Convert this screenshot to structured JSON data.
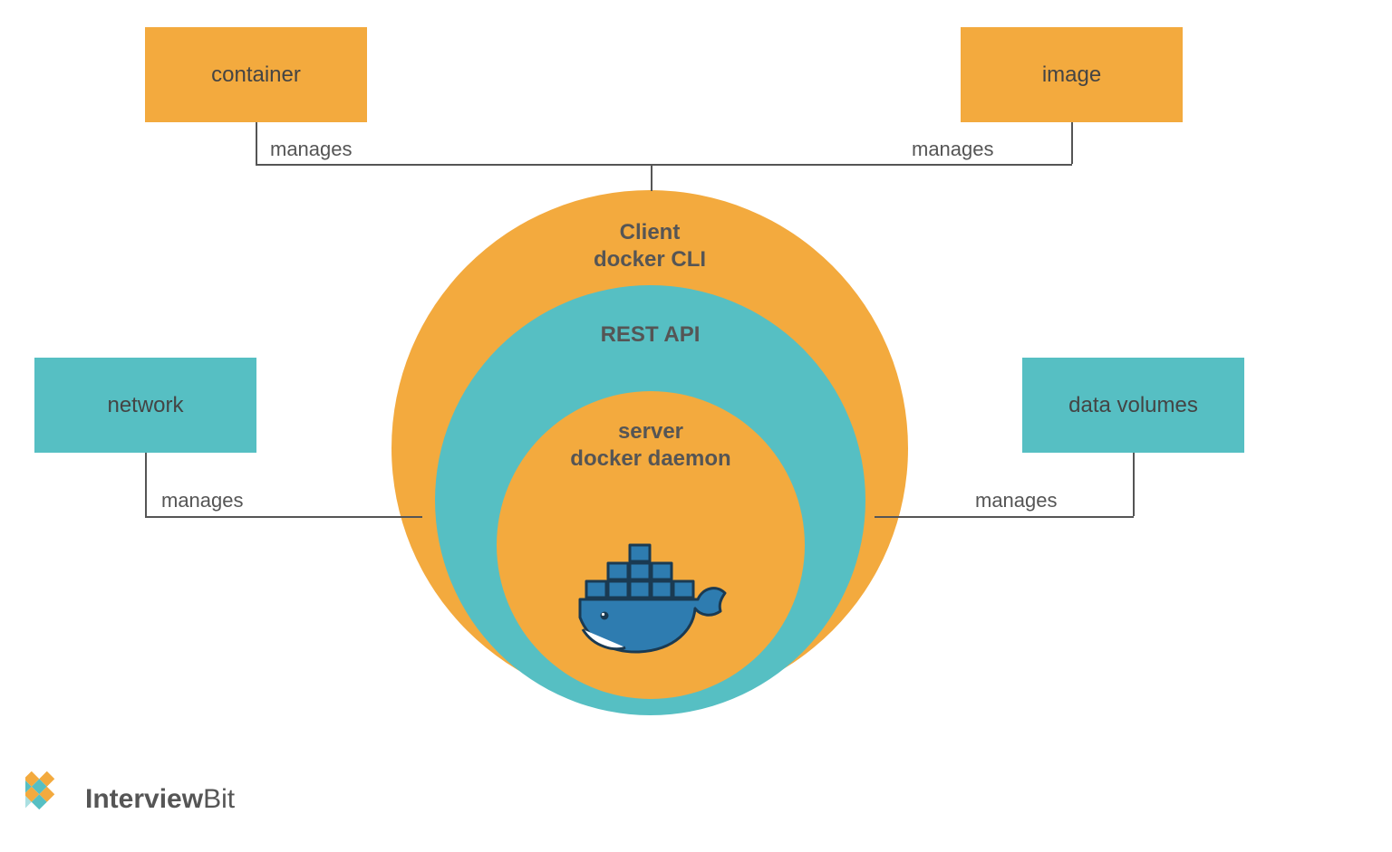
{
  "boxes": {
    "container": "container",
    "image": "image",
    "network": "network",
    "data_volumes": "data volumes"
  },
  "edges": {
    "manages_tl": "manages",
    "manages_tr": "manages",
    "manages_bl": "manages",
    "manages_br": "manages"
  },
  "circles": {
    "outer_line1": "Client",
    "outer_line2": "docker CLI",
    "mid": "REST API",
    "inner_line1": "server",
    "inner_line2": "docker daemon"
  },
  "logo": {
    "name_bold": "Interview",
    "name_light": "Bit"
  },
  "colors": {
    "orange": "#f3aa3e",
    "teal": "#56bfc3",
    "text": "#555"
  }
}
